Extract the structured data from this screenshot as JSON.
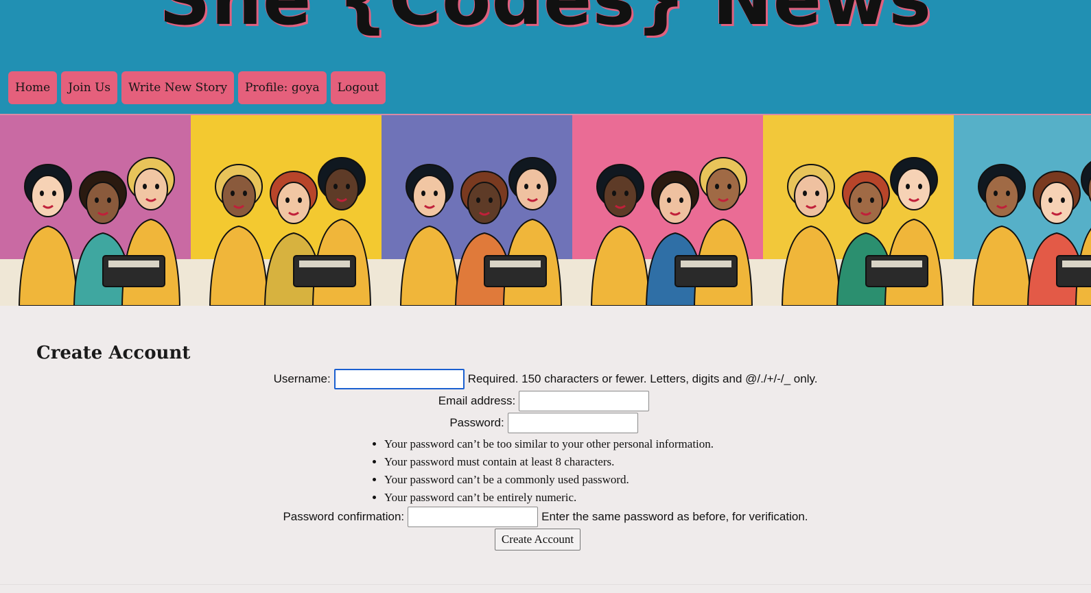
{
  "site": {
    "title": "She {Codes} News"
  },
  "nav": {
    "items": [
      {
        "label": "Home"
      },
      {
        "label": "Join Us"
      },
      {
        "label": "Write New Story"
      },
      {
        "label": "Profile: goya"
      },
      {
        "label": "Logout"
      }
    ]
  },
  "colors": {
    "header_bg": "#2190b3",
    "nav_button": "#e5607c",
    "page_bg": "#efebeb",
    "focus_ring": "#1a5fd0"
  },
  "banner": {
    "panels": [
      {
        "bg": "#c96aa3",
        "accent": "#3fa7a0"
      },
      {
        "bg": "#f3c930",
        "accent": "#d7b23f"
      },
      {
        "bg": "#6f73b8",
        "accent": "#e07a3a"
      },
      {
        "bg": "#ea6c95",
        "accent": "#2f6fa6"
      },
      {
        "bg": "#f2c83a",
        "accent": "#2b8f6f"
      },
      {
        "bg": "#56b0c8",
        "accent": "#e35a47"
      }
    ]
  },
  "form": {
    "title": "Create Account",
    "username": {
      "label": "Username:",
      "value": "",
      "help": "Required. 150 characters or fewer. Letters, digits and @/./+/-/_ only."
    },
    "email": {
      "label": "Email address:",
      "value": ""
    },
    "password": {
      "label": "Password:",
      "value": "",
      "rules": [
        "Your password can’t be too similar to your other personal information.",
        "Your password must contain at least 8 characters.",
        "Your password can’t be a commonly used password.",
        "Your password can’t be entirely numeric."
      ]
    },
    "password_confirmation": {
      "label": "Password confirmation:",
      "value": "",
      "help": "Enter the same password as before, for verification."
    },
    "submit_label": "Create Account"
  }
}
